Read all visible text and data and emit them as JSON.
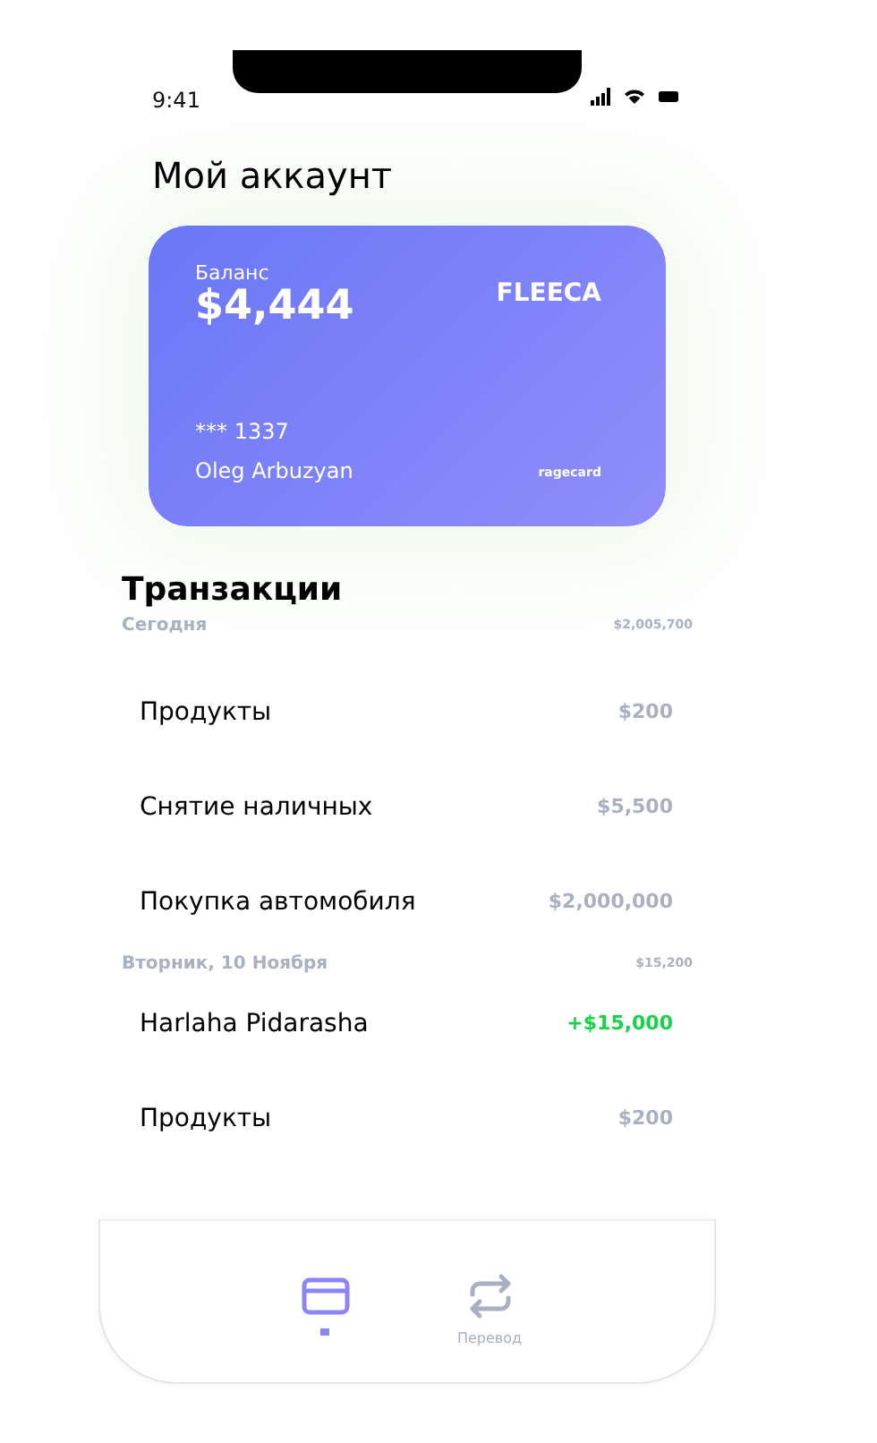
{
  "status_bar": {
    "time": "9:41"
  },
  "title": "Мой аккаунт",
  "card": {
    "balance_label": "Баланс",
    "balance": "$4,444",
    "bank": "FLEECA",
    "number": "*** 1337",
    "holder": "Oleg Arbuzyan",
    "brand": "ragecard"
  },
  "transactions": {
    "title": "Транзакции",
    "groups": [
      {
        "label": "Сегодня",
        "total": "$2,005,700",
        "items": [
          {
            "name": "Продукты",
            "amount": "$200",
            "kind": "expense"
          },
          {
            "name": "Снятие наличных",
            "amount": "$5,500",
            "kind": "expense"
          },
          {
            "name": "Покупка автомобиля",
            "amount": "$2,000,000",
            "kind": "expense"
          }
        ]
      },
      {
        "label": "Вторник, 10 Ноября",
        "total": "$15,200",
        "items": [
          {
            "name": "Harlaha Pidarasha",
            "amount": "+$15,000",
            "kind": "income"
          },
          {
            "name": "Продукты",
            "amount": "$200",
            "kind": "expense"
          }
        ]
      }
    ]
  },
  "tab_bar": {
    "items": [
      {
        "kind": "card",
        "selected": true
      },
      {
        "kind": "transfer",
        "label": "Перевод",
        "selected": false
      }
    ]
  }
}
